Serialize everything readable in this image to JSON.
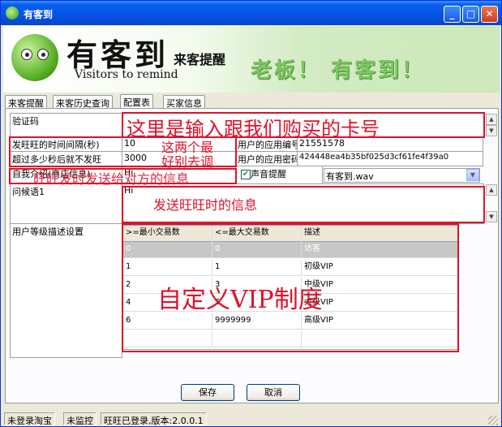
{
  "window": {
    "title": "有客到"
  },
  "banner": {
    "logo_main": "有客到",
    "logo_sub": "来客提醒",
    "logo_en": "Visitors to remind",
    "slogan": "老板！ 有客到！"
  },
  "tabs": [
    {
      "label": "来客提醒"
    },
    {
      "label": "来客历史查询"
    },
    {
      "label": "配置表"
    },
    {
      "label": "买家信息"
    }
  ],
  "form": {
    "verify_code_label": "验证码",
    "interval_label": "发旺旺的时间间隔(秒)",
    "interval_value": "10",
    "timeout_label": "超过多少秒后就不发旺",
    "timeout_value": "3000",
    "app_id_label": "用户的应用编号",
    "app_id_value": "21551578",
    "app_secret_label": "用户的应用密码",
    "app_secret_value": "424448ea4b35bf025d3cf61fe4f39a0",
    "self_intro_label": "自我介绍(商店信息)",
    "self_intro_value": "Hi",
    "sound_label": "声音提醒",
    "sound_checked": true,
    "sound_file": "有客到.wav",
    "greeting_label": "问候语1",
    "greeting_value": "Hi",
    "level_label": "用户等级描述设置"
  },
  "grid": {
    "headers": [
      ">=最小交易数",
      "<=最大交易数",
      "描述"
    ],
    "rows": [
      {
        "min": "0",
        "max": "0",
        "desc": "访客"
      },
      {
        "min": "1",
        "max": "1",
        "desc": "初级VIP"
      },
      {
        "min": "2",
        "max": "3",
        "desc": "中级VIP"
      },
      {
        "min": "4",
        "max": "5",
        "desc": "大级VIP"
      },
      {
        "min": "6",
        "max": "9999999",
        "desc": "高级VIP"
      }
    ]
  },
  "annotations": {
    "card_number": "这里是输入跟我们购买的卡号",
    "tune_line1": "这两个最",
    "tune_line2": "好别去调",
    "self_intro": "旺旺发时发送给对方的信息",
    "greeting": "发送旺旺时的信息",
    "vip": "自定义VIP制度",
    "color": "#e0102a"
  },
  "buttons": {
    "save": "保存",
    "cancel": "取消"
  },
  "status": {
    "taobao": "未登录淘宝",
    "monitor": "未监控",
    "wangwang": "旺旺已登录,版本:2.0.0.1"
  }
}
